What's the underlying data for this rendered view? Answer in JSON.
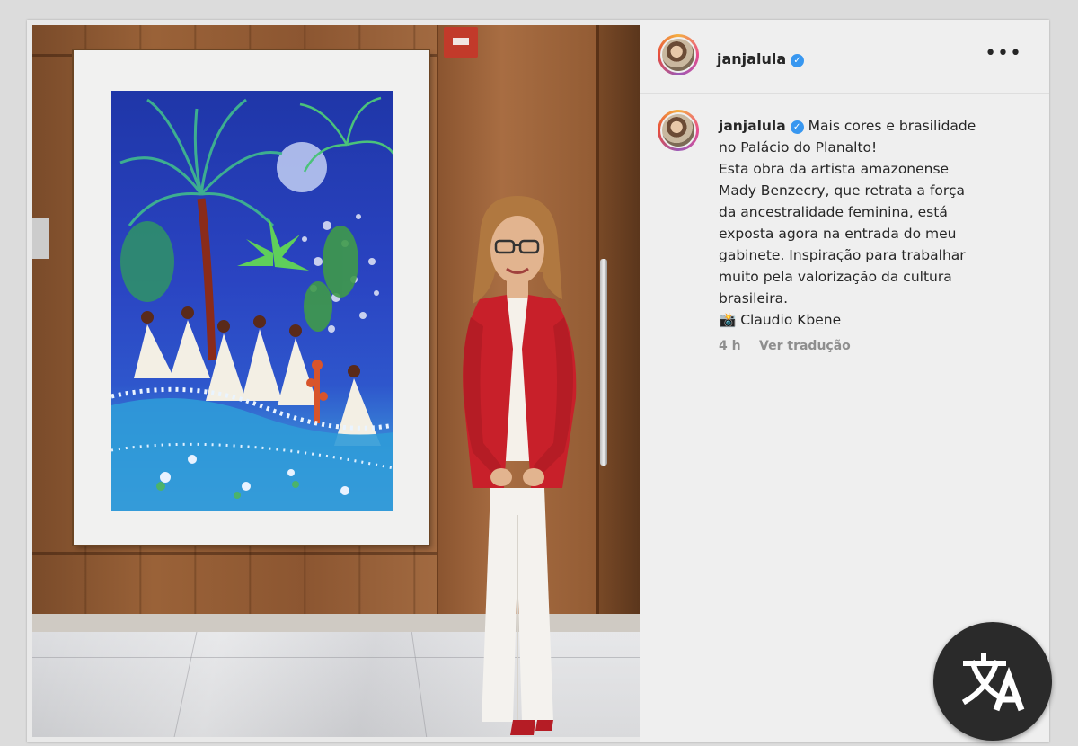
{
  "post": {
    "header": {
      "username": "janjalula",
      "verified": true,
      "more_label": "•••"
    },
    "caption": {
      "username": "janjalula",
      "lines": [
        "Mais cores e brasilidade",
        "no Palácio do Planalto!",
        "Esta obra da artista amazonense",
        "Mady Benzecry, que retrata a força",
        "da ancestralidade feminina, está",
        "exposta agora na entrada do meu",
        "gabinete. Inspiração para trabalhar",
        "muito pela valorização da cultura",
        "brasileira.",
        "📸 Claudio Kbene"
      ]
    },
    "meta": {
      "time": "4 h",
      "translate_link": "Ver tradução"
    }
  },
  "icons": {
    "verified": "verified-badge-icon",
    "more": "more-options-icon",
    "translate": "translate-icon"
  },
  "colors": {
    "verified_blue": "#3897f0",
    "jacket_red": "#c8202a",
    "panel_bg": "#efefef"
  }
}
